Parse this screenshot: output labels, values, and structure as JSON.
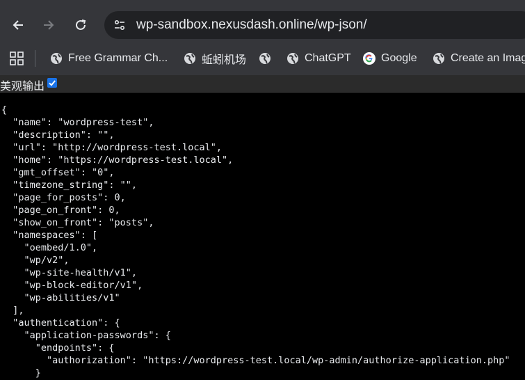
{
  "browser": {
    "url": "wp-sandbox.nexusdash.online/wp-json/",
    "bookmarks": [
      {
        "label": "Free Grammar Ch...",
        "icon": "globe-icon"
      },
      {
        "label": "蚯蚓机场",
        "icon": "globe-icon"
      },
      {
        "label": "",
        "icon": "globe-icon"
      },
      {
        "label": "ChatGPT",
        "icon": "globe-icon"
      },
      {
        "label": "Google",
        "icon": "google-icon"
      },
      {
        "label": "Create an Imag",
        "icon": "globe-icon"
      }
    ]
  },
  "viewer": {
    "pretty_print_label": "美观输出",
    "pretty_print_checked": true
  },
  "json_lines": [
    "{",
    "  \"name\": \"wordpress-test\",",
    "  \"description\": \"\",",
    "  \"url\": \"http://wordpress-test.local\",",
    "  \"home\": \"https://wordpress-test.local\",",
    "  \"gmt_offset\": \"0\",",
    "  \"timezone_string\": \"\",",
    "  \"page_for_posts\": 0,",
    "  \"page_on_front\": 0,",
    "  \"show_on_front\": \"posts\",",
    "  \"namespaces\": [",
    "    \"oembed/1.0\",",
    "    \"wp/v2\",",
    "    \"wp-site-health/v1\",",
    "    \"wp-block-editor/v1\",",
    "    \"wp-abilities/v1\"",
    "  ],",
    "  \"authentication\": {",
    "    \"application-passwords\": {",
    "      \"endpoints\": {",
    "        \"authorization\": \"https://wordpress-test.local/wp-admin/authorize-application.php\"",
    "      }"
  ]
}
